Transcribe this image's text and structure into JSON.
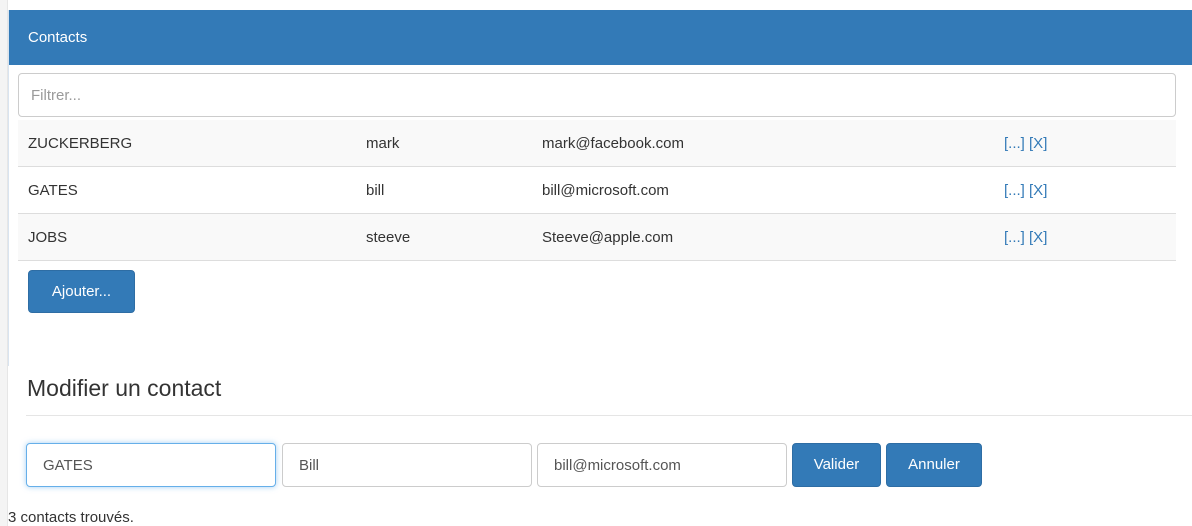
{
  "panel": {
    "title": "Contacts"
  },
  "filter": {
    "placeholder": "Filtrer..."
  },
  "contacts": [
    {
      "last_name": "ZUCKERBERG",
      "first_name": "mark",
      "email": "mark@facebook.com",
      "edit_label": "[...]",
      "delete_label": "[X]"
    },
    {
      "last_name": "GATES",
      "first_name": "bill",
      "email": "bill@microsoft.com",
      "edit_label": "[...]",
      "delete_label": "[X]"
    },
    {
      "last_name": "JOBS",
      "first_name": "steeve",
      "email": "Steeve@apple.com",
      "edit_label": "[...]",
      "delete_label": "[X]"
    }
  ],
  "add_button": "Ajouter...",
  "edit_form": {
    "title": "Modifier un contact",
    "last_name_value": "GATES",
    "first_name_value": "Bill",
    "email_value": "bill@microsoft.com",
    "validate_label": "Valider",
    "cancel_label": "Annuler"
  },
  "status": "3 contacts trouvés.",
  "colors": {
    "primary": "#337ab7",
    "primary_border": "#2e6da4",
    "link": "#337ab7",
    "stripe": "#f9f9f9"
  }
}
